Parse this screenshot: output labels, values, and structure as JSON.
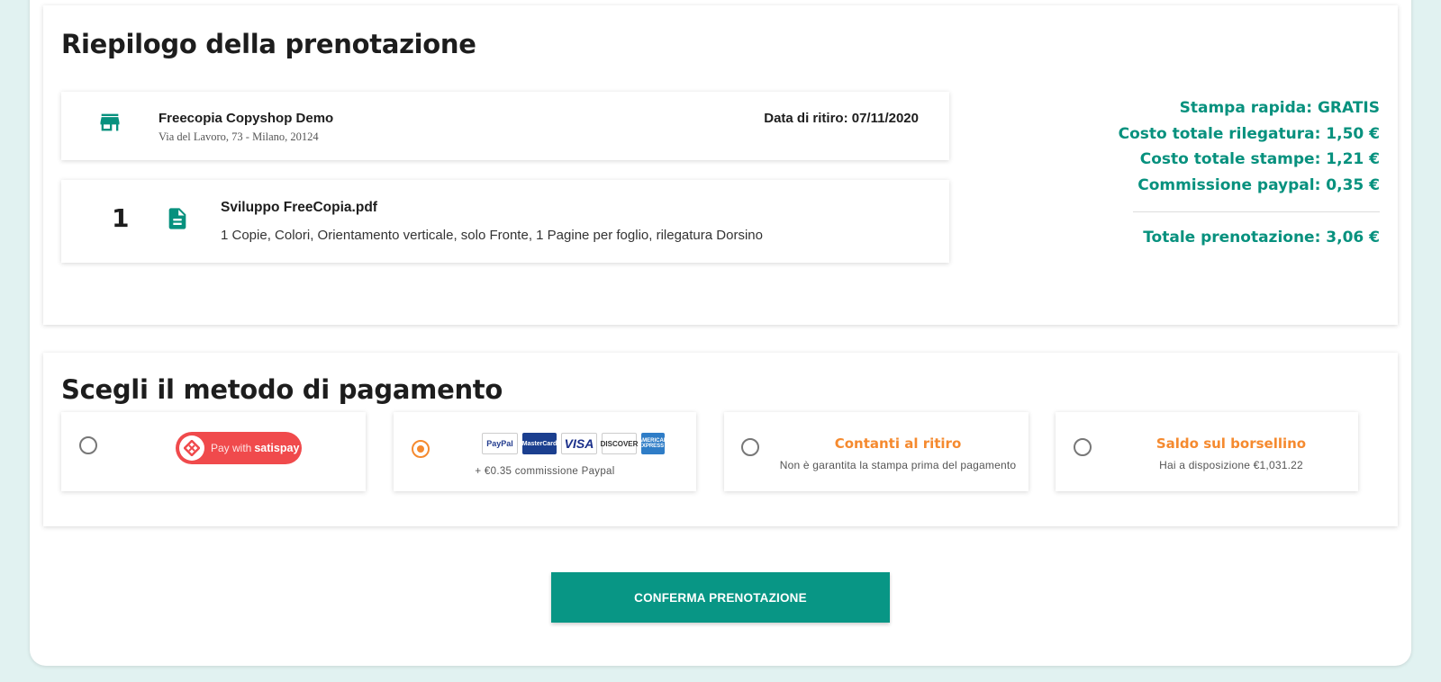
{
  "summary": {
    "title": "Riepilogo della prenotazione",
    "shop": {
      "name": "Freecopia Copyshop Demo",
      "address": "Via del Lavoro, 73 - Milano, 20124",
      "pickup_label": "Data di ritiro:",
      "pickup_date": "07/11/2020",
      "icon": "store-icon"
    },
    "file": {
      "quantity": "1",
      "name": "Sviluppo FreeCopia.pdf",
      "description": "1 Copie, Colori, Orientamento verticale, solo Fronte, 1 Pagine per foglio, rilegatura Dorsino",
      "icon": "document-icon"
    },
    "totals": {
      "fast_print": "Stampa rapida: GRATIS",
      "binding_cost": "Costo totale rilegatura: 1,50 €",
      "print_cost": "Costo totale stampe: 1,21 €",
      "paypal_fee": "Commissione paypal: 0,35 €",
      "total": "Totale prenotazione: 3,06 €"
    }
  },
  "payment": {
    "title": "Scegli il metodo di pagamento",
    "options": [
      {
        "id": "satispay",
        "selected": false,
        "label": "Pay with",
        "brand": "satispay"
      },
      {
        "id": "paypal",
        "selected": true,
        "logos": [
          "PayPal",
          "MasterCard",
          "VISA",
          "DISCOVER",
          "AMERICAN EXPRESS"
        ],
        "fee_note": "+ €0.35 commissione Paypal"
      },
      {
        "id": "cash",
        "selected": false,
        "title": "Contanti al ritiro",
        "subtitle": "Non è garantita la stampa prima del pagamento"
      },
      {
        "id": "wallet",
        "selected": false,
        "title": "Saldo sul borsellino",
        "subtitle": "Hai a disposizione €1,031.22"
      }
    ]
  },
  "confirm_button": "CONFERMA PRENOTAZIONE",
  "colors": {
    "accent_teal": "#07917e",
    "accent_orange": "#f58a2f",
    "background": "#e1f2f1",
    "satispay_red": "#f04a4c"
  }
}
